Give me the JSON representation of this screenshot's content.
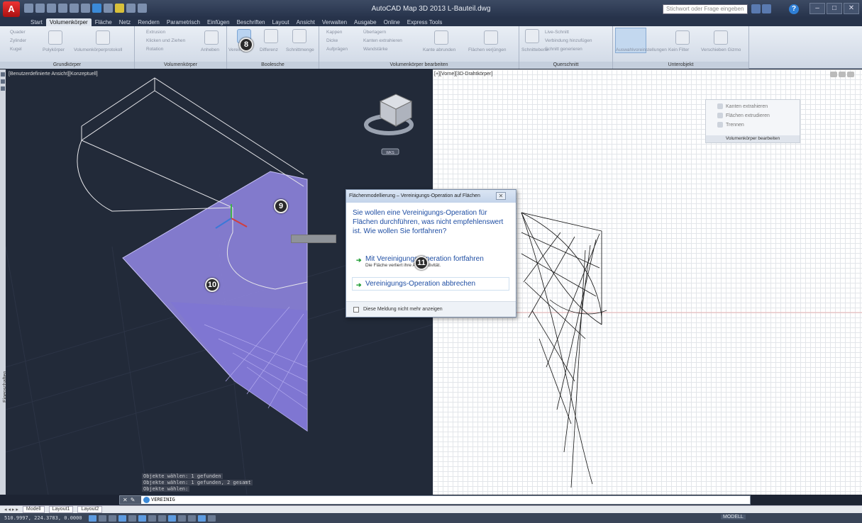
{
  "window": {
    "title": "AutoCAD Map 3D 2013  L-Bauteil.dwg",
    "search_placeholder": "Stichwort oder Frage eingeben",
    "app_letter": "A",
    "controls": [
      "–",
      "□",
      "✕"
    ]
  },
  "ribbon_tabs": [
    {
      "label": "Start"
    },
    {
      "label": "Volumenkörper",
      "active": true
    },
    {
      "label": "Fläche"
    },
    {
      "label": "Netz"
    },
    {
      "label": "Rendern"
    },
    {
      "label": "Parametrisch"
    },
    {
      "label": "Einfügen"
    },
    {
      "label": "Beschriften"
    },
    {
      "label": "Layout"
    },
    {
      "label": "Ansicht"
    },
    {
      "label": "Verwalten"
    },
    {
      "label": "Ausgabe"
    },
    {
      "label": "Online"
    },
    {
      "label": "Express Tools"
    }
  ],
  "ribbon": {
    "groups": {
      "grundkoerper": {
        "title": "Grundkörper",
        "buttons": [
          "Quader",
          "Zylinder",
          "Kugel",
          "Polykörper",
          "Volumenkörperprotokoll"
        ]
      },
      "volumenkoerper": {
        "title": "Volumenkörper",
        "buttons": [
          "Extrusion",
          "Klicken und Ziehen",
          "Rotation",
          "Anheben"
        ]
      },
      "boolesche": {
        "title": "Boolesche",
        "buttons": [
          "Vereinig",
          "Differenz",
          "Schnittmenge"
        ]
      },
      "bearbeiten": {
        "title": "Volumenkörper bearbeiten",
        "buttons": [
          "Kappen",
          "Dicke",
          "Aufprägen",
          "Überlagern",
          "Kanten extrahieren",
          "Wandstärke",
          "Kante abrunden",
          "Flächen verjüngen"
        ]
      },
      "querschnitt": {
        "title": "Querschnitt",
        "buttons": [
          "Schnittebene",
          "Live-Schnitt",
          "Verbindung hinzufügen",
          "Schnitt generieren"
        ]
      },
      "unterobjekt": {
        "title": "Unterobjekt",
        "buttons": [
          "Auswahlvoreinstellungen",
          "Kein Filter",
          "Verschieben Gizmo"
        ]
      }
    }
  },
  "viewports": {
    "left": {
      "label": "[Benutzerdefinierte Ansicht][Konzeptuell]",
      "viewcube_label": "WKS"
    },
    "right": {
      "label": "[+][Vorne][3D-Drahtkörper]"
    }
  },
  "side_palette": {
    "label": "Eigenschaften"
  },
  "mini_panel": {
    "rows": [
      "Kanten extrahieren",
      "Flächen extrudieren",
      "Trennen"
    ],
    "title": "Volumenkörper bearbeiten"
  },
  "dialog": {
    "title": "Flächenmodellierung – Vereinigungs-Operation auf Flächen",
    "message": "Sie wollen eine Vereinigungs-Operation für Flächen durchführen, was nicht empfehlenswert ist. Wie wollen Sie fortfahren?",
    "option1": {
      "main": "Mit Vereinigungs-Operation fortfahren",
      "sub": "Die Fläche verliert ihre Assoziativität."
    },
    "option2": {
      "main": "Vereinigungs-Operation abbrechen"
    },
    "footer_checkbox": "Diese Meldung nicht mehr anzeigen"
  },
  "callouts": [
    "8",
    "9",
    "10",
    "11"
  ],
  "command": {
    "history": [
      "Objekte wählen: 1 gefunden",
      "Objekte wählen: 1 gefunden, 2 gesamt",
      "Objekte wählen:"
    ],
    "current": "VEREINIG"
  },
  "layout_tabs": [
    "Modell",
    "Layout1",
    "Layout2"
  ],
  "status": {
    "coords": "510.9997, 224.3783, 0.0000",
    "model": "MODELL"
  },
  "colors": {
    "accent": "#8f85e0",
    "viewport_bg": "#222a39",
    "dialog_text": "#1f4ea3"
  }
}
